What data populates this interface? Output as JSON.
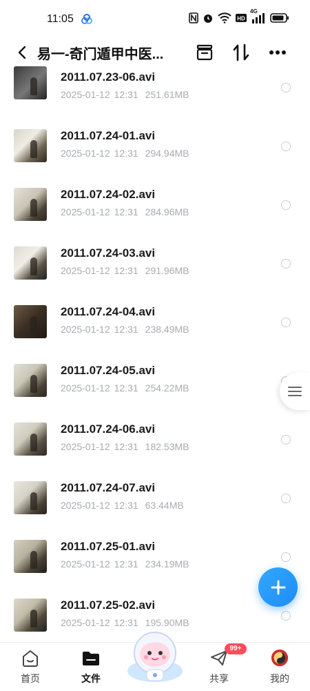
{
  "status_bar": {
    "time": "11:05",
    "network": "4G"
  },
  "header": {
    "title": "易一-奇门遁甲中医..."
  },
  "files": [
    {
      "name": "2011.07.23-06.avi",
      "date": "2025-01-12",
      "time": "12:31",
      "size": "251.61MB"
    },
    {
      "name": "2011.07.24-01.avi",
      "date": "2025-01-12",
      "time": "12:31",
      "size": "294.94MB"
    },
    {
      "name": "2011.07.24-02.avi",
      "date": "2025-01-12",
      "time": "12:31",
      "size": "284.96MB"
    },
    {
      "name": "2011.07.24-03.avi",
      "date": "2025-01-12",
      "time": "12:31",
      "size": "291.96MB"
    },
    {
      "name": "2011.07.24-04.avi",
      "date": "2025-01-12",
      "time": "12:31",
      "size": "238.49MB"
    },
    {
      "name": "2011.07.24-05.avi",
      "date": "2025-01-12",
      "time": "12:31",
      "size": "254.22MB"
    },
    {
      "name": "2011.07.24-06.avi",
      "date": "2025-01-12",
      "time": "12:31",
      "size": "182.53MB"
    },
    {
      "name": "2011.07.24-07.avi",
      "date": "2025-01-12",
      "time": "12:31",
      "size": "63.44MB"
    },
    {
      "name": "2011.07.25-01.avi",
      "date": "2025-01-12",
      "time": "12:31",
      "size": "234.19MB"
    },
    {
      "name": "2011.07.25-02.avi",
      "date": "2025-01-12",
      "time": "12:31",
      "size": "195.90MB"
    }
  ],
  "bottom_nav": {
    "items": [
      {
        "label": "首页",
        "icon": "home-icon"
      },
      {
        "label": "文件",
        "icon": "folder-icon"
      },
      {
        "label": "共享",
        "icon": "paper-plane-icon"
      },
      {
        "label": "我的",
        "icon": "avatar-icon"
      }
    ],
    "badge": "99+"
  },
  "colors": {
    "accent": "#1e8cf5",
    "badge": "#ff4d5b",
    "meta_text": "#a7abb2"
  }
}
